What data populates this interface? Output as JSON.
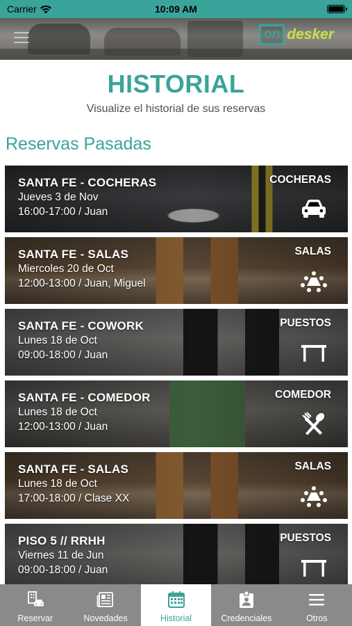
{
  "status_bar": {
    "carrier": "Carrier",
    "time": "10:09 AM",
    "wifi_icon": "wifi-icon",
    "battery_icon": "battery-icon"
  },
  "header": {
    "menu_icon": "hamburger-menu-icon",
    "logo": {
      "box_text": "on",
      "text": "desker",
      "box_color": "#3aa39a",
      "text_color": "#c9e04a"
    }
  },
  "page": {
    "title": "HISTORIAL",
    "subtitle": "Visualize el historial de sus reservas",
    "section_title": "Reservas Pasadas"
  },
  "reservations": [
    {
      "title": "SANTA FE - COCHERAS",
      "date": "Jueves 3 de Nov",
      "detail": "16:00-17:00 / Juan",
      "type": "COCHERAS",
      "icon": "car-icon"
    },
    {
      "title": "SANTA FE - SALAS",
      "date": "Miercoles 20 de Oct",
      "detail": "12:00-13:00 / Juan, Miguel",
      "type": "SALAS",
      "icon": "meeting-table-icon"
    },
    {
      "title": "SANTA FE - COWORK",
      "date": "Lunes 18 de Oct",
      "detail": "09:00-18:00 / Juan",
      "type": "PUESTOS",
      "icon": "desk-icon"
    },
    {
      "title": "SANTA FE - COMEDOR",
      "date": "Lunes 18 de Oct",
      "detail": "12:00-13:00 / Juan",
      "type": "COMEDOR",
      "icon": "fork-spoon-icon"
    },
    {
      "title": "SANTA FE - SALAS",
      "date": "Lunes 18 de Oct",
      "detail": "17:00-18:00 / Clase XX",
      "type": "SALAS",
      "icon": "meeting-table-icon"
    },
    {
      "title": "PISO 5 // RRHH",
      "date": "Viernes 11 de Jun",
      "detail": "09:00-18:00 / Juan",
      "type": "PUESTOS",
      "icon": "desk-icon"
    }
  ],
  "tabbar": [
    {
      "label": "Reservar",
      "icon": "building-car-icon",
      "active": false
    },
    {
      "label": "Novedades",
      "icon": "newspaper-icon",
      "active": false
    },
    {
      "label": "Historial",
      "icon": "calendar-icon",
      "active": true
    },
    {
      "label": "Credenciales",
      "icon": "badge-icon",
      "active": false
    },
    {
      "label": "Otros",
      "icon": "menu-icon",
      "active": false
    }
  ],
  "colors": {
    "accent": "#3aa39a",
    "tabbar": "#8a8a8a",
    "logo_green": "#c9e04a"
  }
}
